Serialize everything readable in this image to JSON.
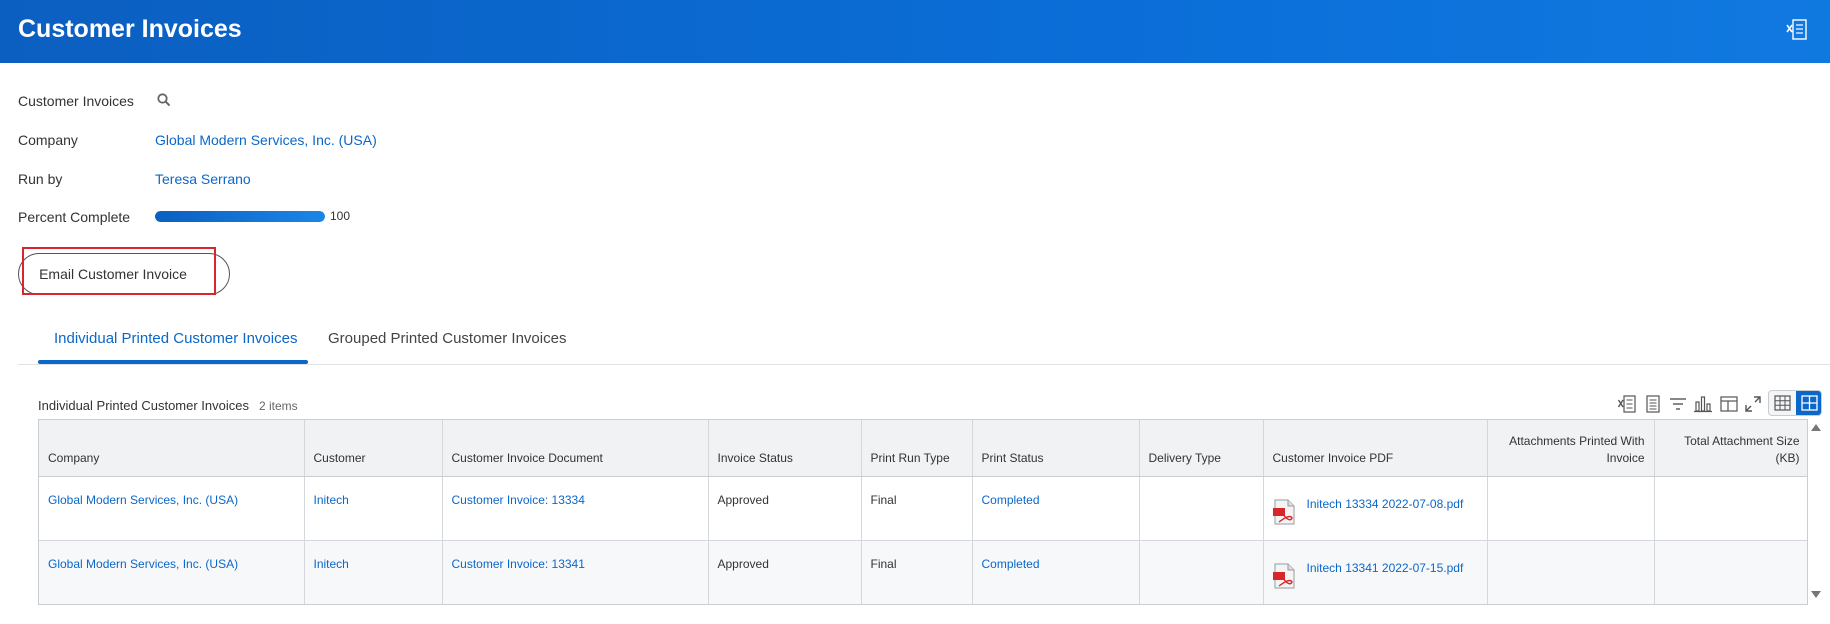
{
  "header": {
    "title": "Customer Invoices",
    "export_icon": "excel-export-icon"
  },
  "fields": {
    "customer_invoices_label": "Customer Invoices",
    "search_icon": "search-icon",
    "company_label": "Company",
    "company_value": "Global Modern Services, Inc. (USA)",
    "run_by_label": "Run by",
    "run_by_value": "Teresa Serrano",
    "percent_complete_label": "Percent Complete",
    "percent_complete_value": "100",
    "percent_complete_fraction": 1.0
  },
  "actions": {
    "email_button_label": "Email Customer Invoice"
  },
  "tabs": [
    {
      "label": "Individual Printed Customer Invoices",
      "active": true
    },
    {
      "label": "Grouped Printed Customer Invoices",
      "active": false
    }
  ],
  "grid": {
    "title": "Individual Printed Customer Invoices",
    "count": "2 items",
    "toolbar_icons": [
      "excel-export-icon",
      "print-icon",
      "filter-icon",
      "chart-icon",
      "column-layout-icon",
      "fullscreen-icon"
    ],
    "view_toggle_icons": [
      "table-view-icon",
      "grid-view-icon"
    ],
    "columns": [
      "Company",
      "Customer",
      "Customer Invoice Document",
      "Invoice Status",
      "Print Run Type",
      "Print Status",
      "Delivery Type",
      "Customer Invoice PDF",
      "Attachments Printed With Invoice",
      "Total Attachment Size (KB)"
    ],
    "rows": [
      {
        "company": "Global Modern Services, Inc. (USA)",
        "customer": "Initech",
        "document": "Customer Invoice: 13334",
        "invoice_status": "Approved",
        "print_run_type": "Final",
        "print_status": "Completed",
        "delivery_type": "",
        "pdf": "Initech 13334 2022-07-08.pdf",
        "attachments": "",
        "attachment_size": ""
      },
      {
        "company": "Global Modern Services, Inc. (USA)",
        "customer": "Initech",
        "document": "Customer Invoice: 13341",
        "invoice_status": "Approved",
        "print_run_type": "Final",
        "print_status": "Completed",
        "delivery_type": "",
        "pdf": "Initech 13341 2022-07-15.pdf",
        "attachments": "",
        "attachment_size": ""
      }
    ]
  },
  "colors": {
    "header_blue": "#0b6ed8",
    "link_blue": "#0b67c9",
    "highlight_red": "#d9262d"
  }
}
